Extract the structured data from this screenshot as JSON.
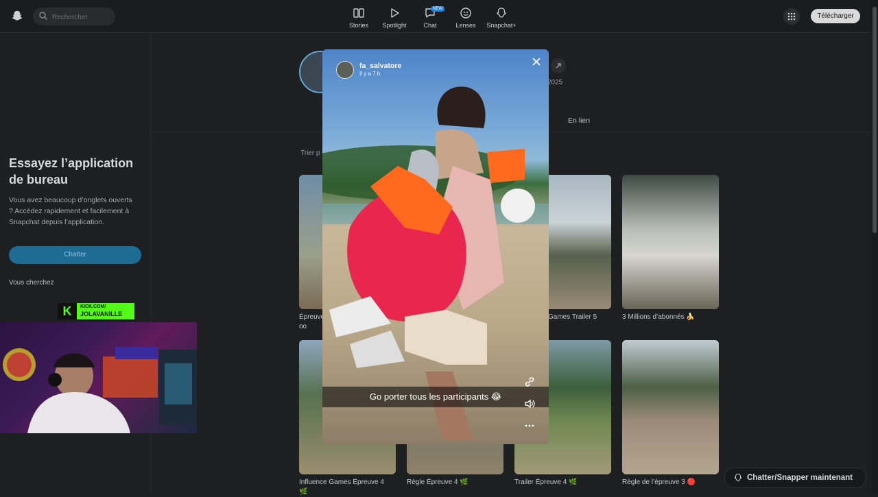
{
  "search": {
    "placeholder": "Rechercher"
  },
  "nav": [
    {
      "label": "Stories"
    },
    {
      "label": "Spotlight"
    },
    {
      "label": "Chat",
      "badge": "NEW"
    },
    {
      "label": "Lenses"
    },
    {
      "label": "Snapchat+"
    }
  ],
  "header": {
    "download_label": "Télécharger"
  },
  "sidebar": {
    "promo_title": "Essayez l’application de bureau",
    "promo_text": "Vous avez beaucoup d’onglets ouverts ? Accédez rapidement et facilement à Snapchat depuis l’application.",
    "chat_button": "Chatter",
    "looking_for": "Vous cherchez"
  },
  "profile": {
    "year_fragment": "2025",
    "tab_link": "En lien",
    "sort_label": "Trier p"
  },
  "cards": [
    {
      "caption": "Épreuve\noo"
    },
    {
      "caption": "Games Trailer 5"
    },
    {
      "caption": "3 Millions d’abonnés 🍌"
    },
    {
      "caption": "Influence Games Épreuve 4\n🌿"
    },
    {
      "caption": "Règle Épreuve 4 🌿"
    },
    {
      "caption": "Trailer Épreuve 4 🌿"
    },
    {
      "caption": "Règle de l’épreuve 3 🔴"
    }
  ],
  "story": {
    "username": "fa_salvatore",
    "time": "Il y a 7 h",
    "caption": "Go porter tous les participants 😂"
  },
  "overlay": {
    "kick_line1": "KICK.COM/",
    "kick_line2": "JOLAVANILLE",
    "kick_letter": "K"
  },
  "chat_now": {
    "label": "Chatter/Snapper maintenant"
  }
}
